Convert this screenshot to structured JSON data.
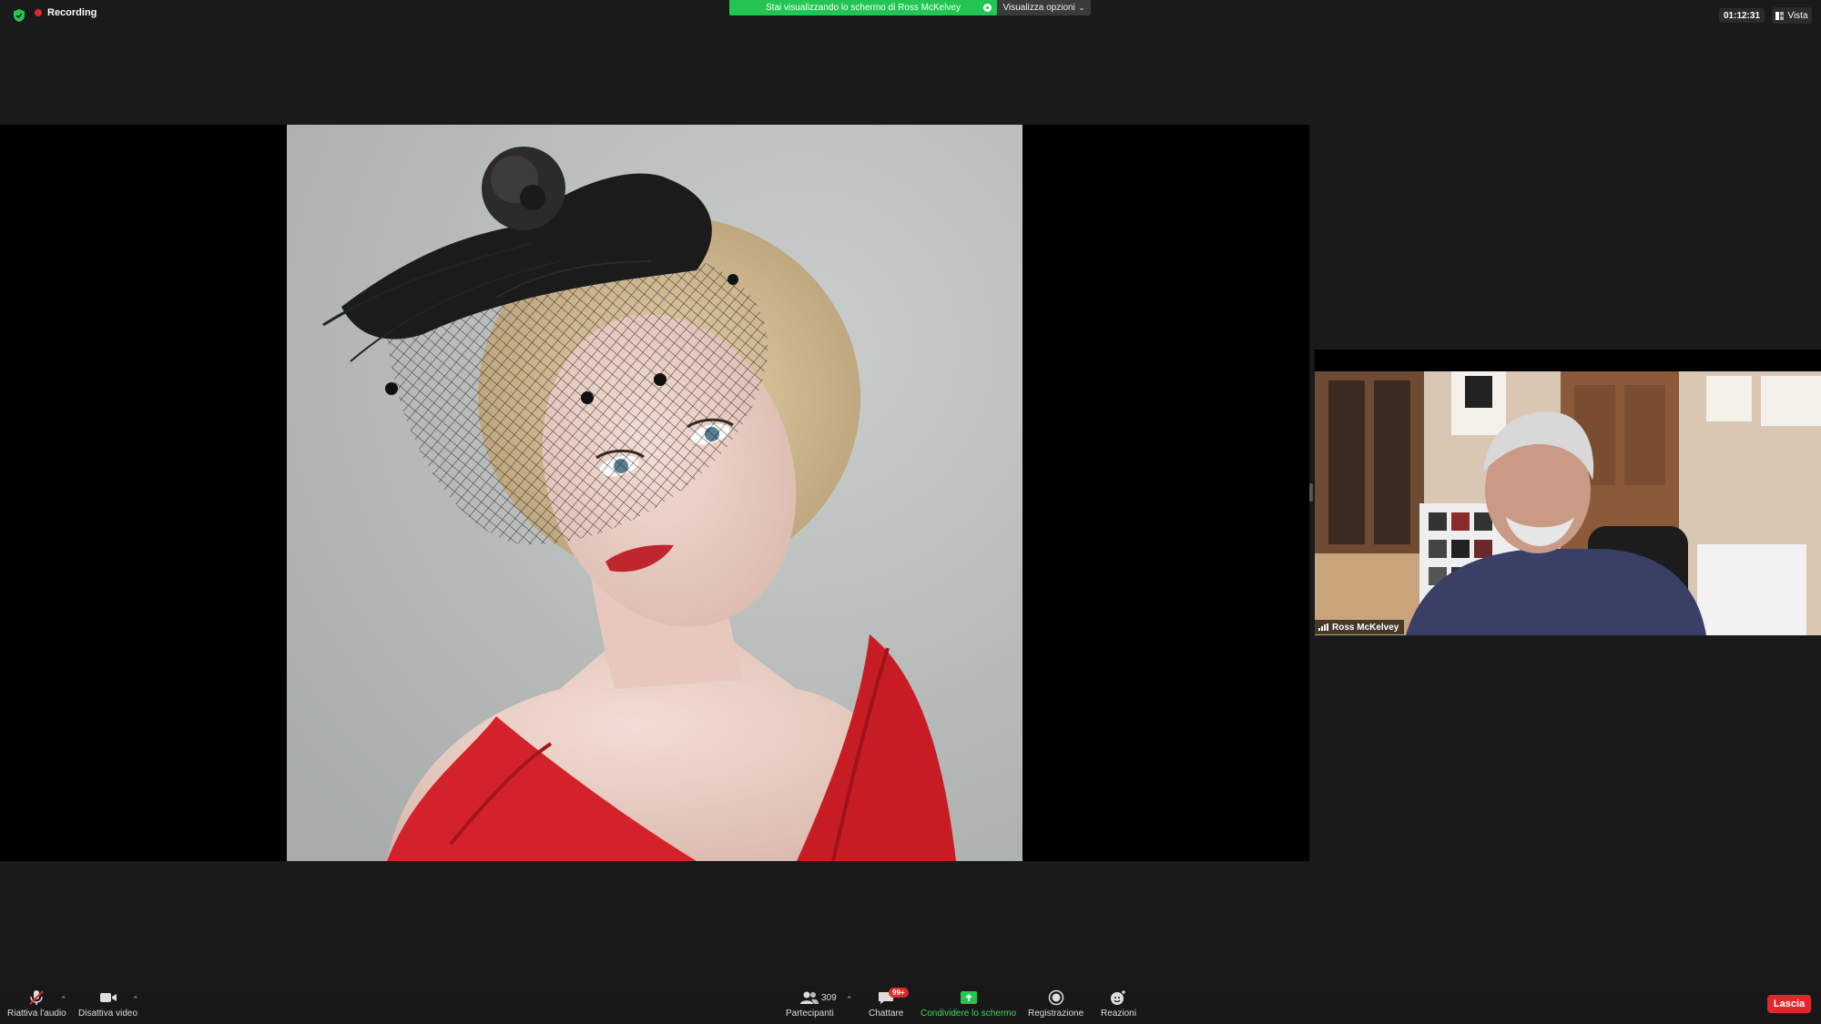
{
  "topbar": {
    "recording_label": "Recording",
    "share_banner_text": "Stai visualizzando lo schermo di Ross McKelvey",
    "view_options_label": "Visualizza opzioni",
    "meeting_timer": "01:12:31",
    "view_label": "Vista"
  },
  "participant": {
    "name": "Ross McKelvey"
  },
  "toolbar": {
    "unmute_label": "Riattiva l'audio",
    "video_label": "Disattiva video",
    "participants_label": "Partecipanti",
    "participants_count": "309",
    "chat_label": "Chattare",
    "chat_badge": "99+",
    "share_label": "Condividere lo schermo",
    "record_label": "Registrazione",
    "reactions_label": "Reazioni",
    "leave_label": "Lascia"
  },
  "colors": {
    "share_green": "#23c552",
    "leave_red": "#e0282c",
    "recording_red": "#e02828"
  }
}
